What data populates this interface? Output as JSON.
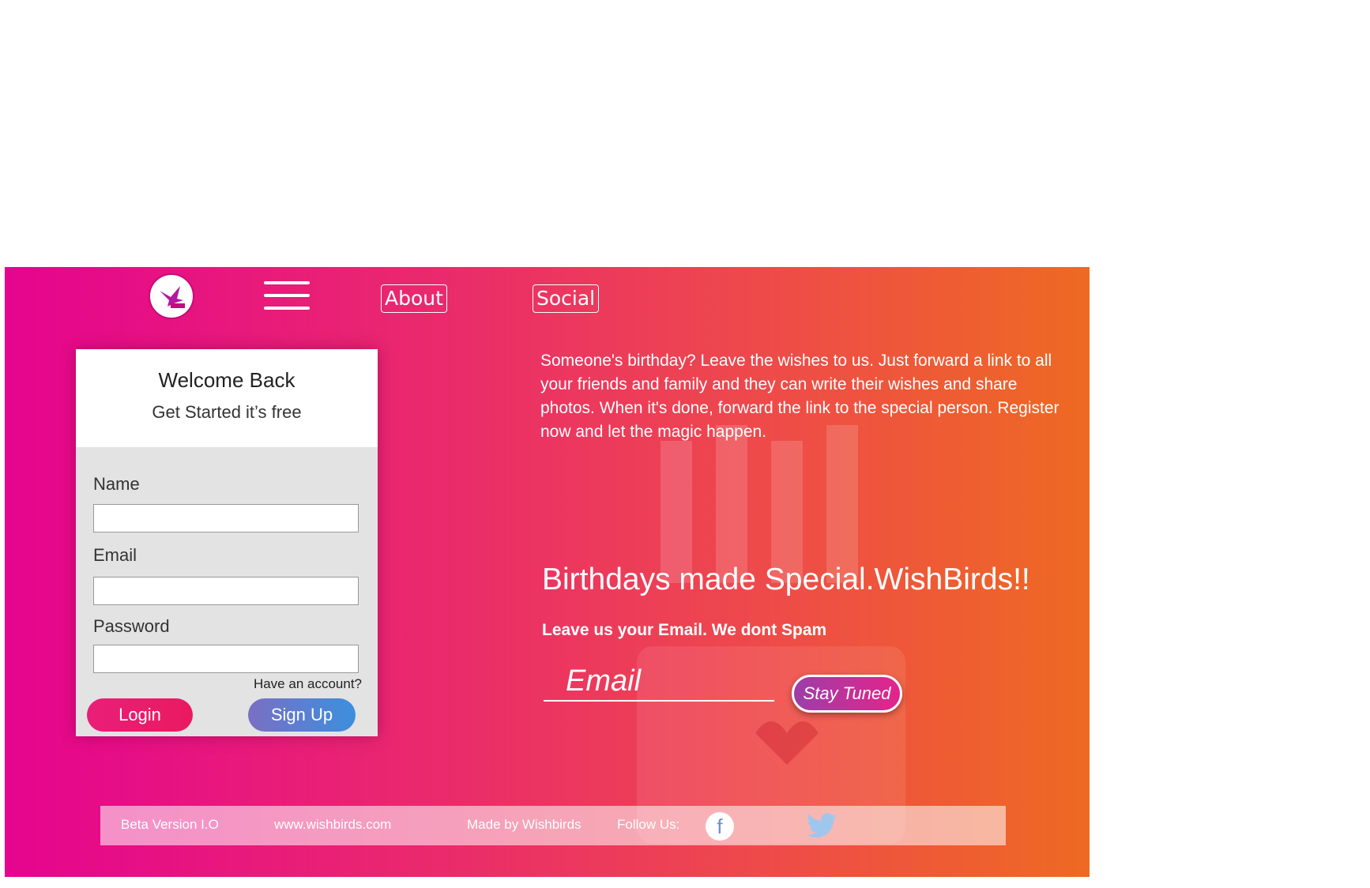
{
  "nav": {
    "about_label": "About",
    "social_label": "Social"
  },
  "card": {
    "title": "Welcome Back",
    "subtitle": "Get Started it’s free",
    "fields": {
      "name_label": "Name",
      "email_label": "Email",
      "password_label": "Password"
    },
    "have_account": "Have an account?",
    "login_label": "Login",
    "signup_label": "Sign Up"
  },
  "main": {
    "intro": "Someone's birthday? Leave the wishes to us. Just forward a link to all your friends and family and they can write their wishes and share photos. When it's done, forward the link to the special person. Register now and let the magic happen.",
    "tagline": "Birthdays made Special.WishBirds!!",
    "email_note": "Leave us your Email. We dont Spam",
    "email_placeholder": "Email",
    "stay_tuned_label": "Stay Tuned"
  },
  "footer": {
    "version": "Beta Version I.O",
    "website": "www.wishbirds.com",
    "made_by": "Made by Wishbirds",
    "follow_us": "Follow Us:",
    "facebook_glyph": "f"
  },
  "icons": {
    "logo": "bird-logo-icon",
    "menu": "hamburger-menu-icon",
    "facebook": "facebook-icon",
    "twitter": "twitter-icon"
  },
  "colors": {
    "gradient_start": "#e5048f",
    "gradient_end": "#ee6a22",
    "login": "#e91e78",
    "signup": "#3c8fdd"
  }
}
